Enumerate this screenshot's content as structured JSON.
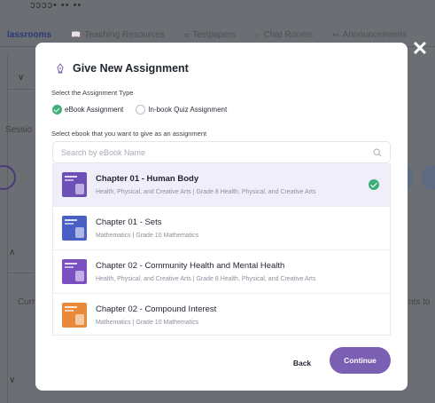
{
  "background": {
    "top_fragment": "ɔɔɔɔ• •• ••",
    "tabs": [
      {
        "label": "lassrooms",
        "icon": "classroom-icon"
      },
      {
        "label": "Teaching Resources",
        "icon": "book-icon"
      },
      {
        "label": "Testpapers",
        "icon": "paper-icon"
      },
      {
        "label": "Chat Rooms",
        "icon": "chat-icon"
      },
      {
        "label": "Announcements",
        "icon": "megaphone-icon"
      }
    ],
    "session_text": "Sessio",
    "curr_text": "Curr",
    "nts_to_text": "nts to"
  },
  "modal": {
    "title": "Give New Assignment",
    "type_label": "Select the Assignment Type",
    "types": [
      {
        "label": "eBook Assignment",
        "selected": true
      },
      {
        "label": "In-book Quiz Assignment",
        "selected": false
      }
    ],
    "ebook_label": "Select ebook that you want to give as an assignment",
    "search_placeholder": "Search by eBook Name",
    "ebooks": [
      {
        "title": "Chapter 01 - Human Body",
        "subtitle": "Health, Physical, and Creative Arts | Grade 8 Health, Physical, and Creative Arts",
        "selected": true,
        "thumb_color": "#6d4fb8"
      },
      {
        "title": "Chapter 01 - Sets",
        "subtitle": "Mathematics | Grade 10 Mathematics",
        "selected": false,
        "thumb_color": "#4a5fc4"
      },
      {
        "title": "Chapter 02 - Community Health and Mental Health",
        "subtitle": "Health, Physical, and Creative Arts | Grade 8 Health, Physical, and Creative Arts",
        "selected": false,
        "thumb_color": "#7a4fc0"
      },
      {
        "title": "Chapter 02 - Compound Interest",
        "subtitle": "Mathematics | Grade 10 Mathematics",
        "selected": false,
        "thumb_color": "#e88a3a"
      }
    ],
    "back_label": "Back",
    "continue_label": "Continue"
  },
  "colors": {
    "accent": "#7b5fb3",
    "success": "#3fae78"
  }
}
